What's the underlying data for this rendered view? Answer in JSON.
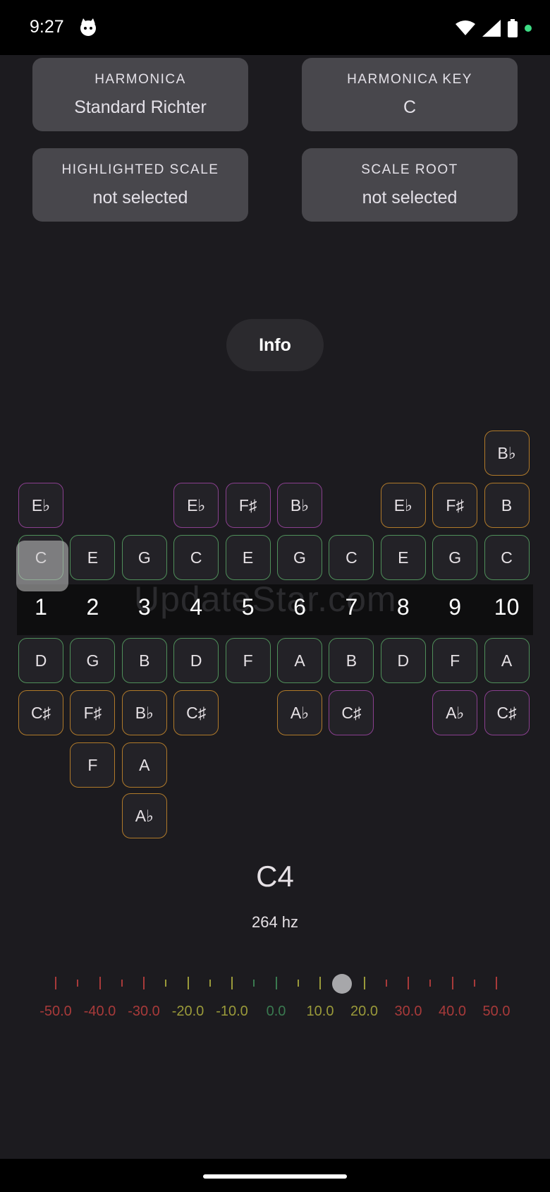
{
  "status": {
    "time": "9:27"
  },
  "cards": {
    "harmonica_label": "HARMONICA",
    "harmonica_value": "Standard Richter",
    "key_label": "HARMONICA KEY",
    "key_value": "C",
    "scale_label": "HIGHLIGHTED SCALE",
    "scale_value": "not selected",
    "root_label": "SCALE ROOT",
    "root_value": "not selected"
  },
  "info_label": "Info",
  "watermark": "UpdateStar.com",
  "holes": [
    "1",
    "2",
    "3",
    "4",
    "5",
    "6",
    "7",
    "8",
    "9",
    "10"
  ],
  "notes": {
    "r1": [
      "",
      "",
      "",
      "",
      "",
      "",
      "",
      "",
      "",
      "B♭"
    ],
    "r2": [
      "E♭",
      "",
      "",
      "E♭",
      "F♯",
      "B♭",
      "",
      "E♭",
      "F♯",
      "B"
    ],
    "r3": [
      "C",
      "E",
      "G",
      "C",
      "E",
      "G",
      "C",
      "E",
      "G",
      "C"
    ],
    "r4": [
      "D",
      "G",
      "B",
      "D",
      "F",
      "A",
      "B",
      "D",
      "F",
      "A"
    ],
    "r5": [
      "C♯",
      "F♯",
      "B♭",
      "C♯",
      "",
      "A♭",
      "C♯",
      "",
      "A♭",
      "C♯"
    ],
    "r6": [
      "",
      "F",
      "A",
      "",
      "",
      "",
      "",
      "",
      "",
      ""
    ],
    "r7": [
      "",
      "",
      "A♭",
      "",
      "",
      "",
      "",
      "",
      "",
      ""
    ]
  },
  "current_note": "C4",
  "frequency": "264 hz",
  "tuner": {
    "labels": [
      "-50.0",
      "-40.0",
      "-30.0",
      "-20.0",
      "-10.0",
      "0.0",
      "10.0",
      "20.0",
      "30.0",
      "40.0",
      "50.0"
    ],
    "colors": [
      "#a83a3a",
      "#a83a3a",
      "#a83a3a",
      "#9a9a3a",
      "#9a9a3a",
      "#3a7a50",
      "#9a9a3a",
      "#9a9a3a",
      "#a83a3a",
      "#a83a3a",
      "#a83a3a"
    ],
    "cents": 15
  }
}
